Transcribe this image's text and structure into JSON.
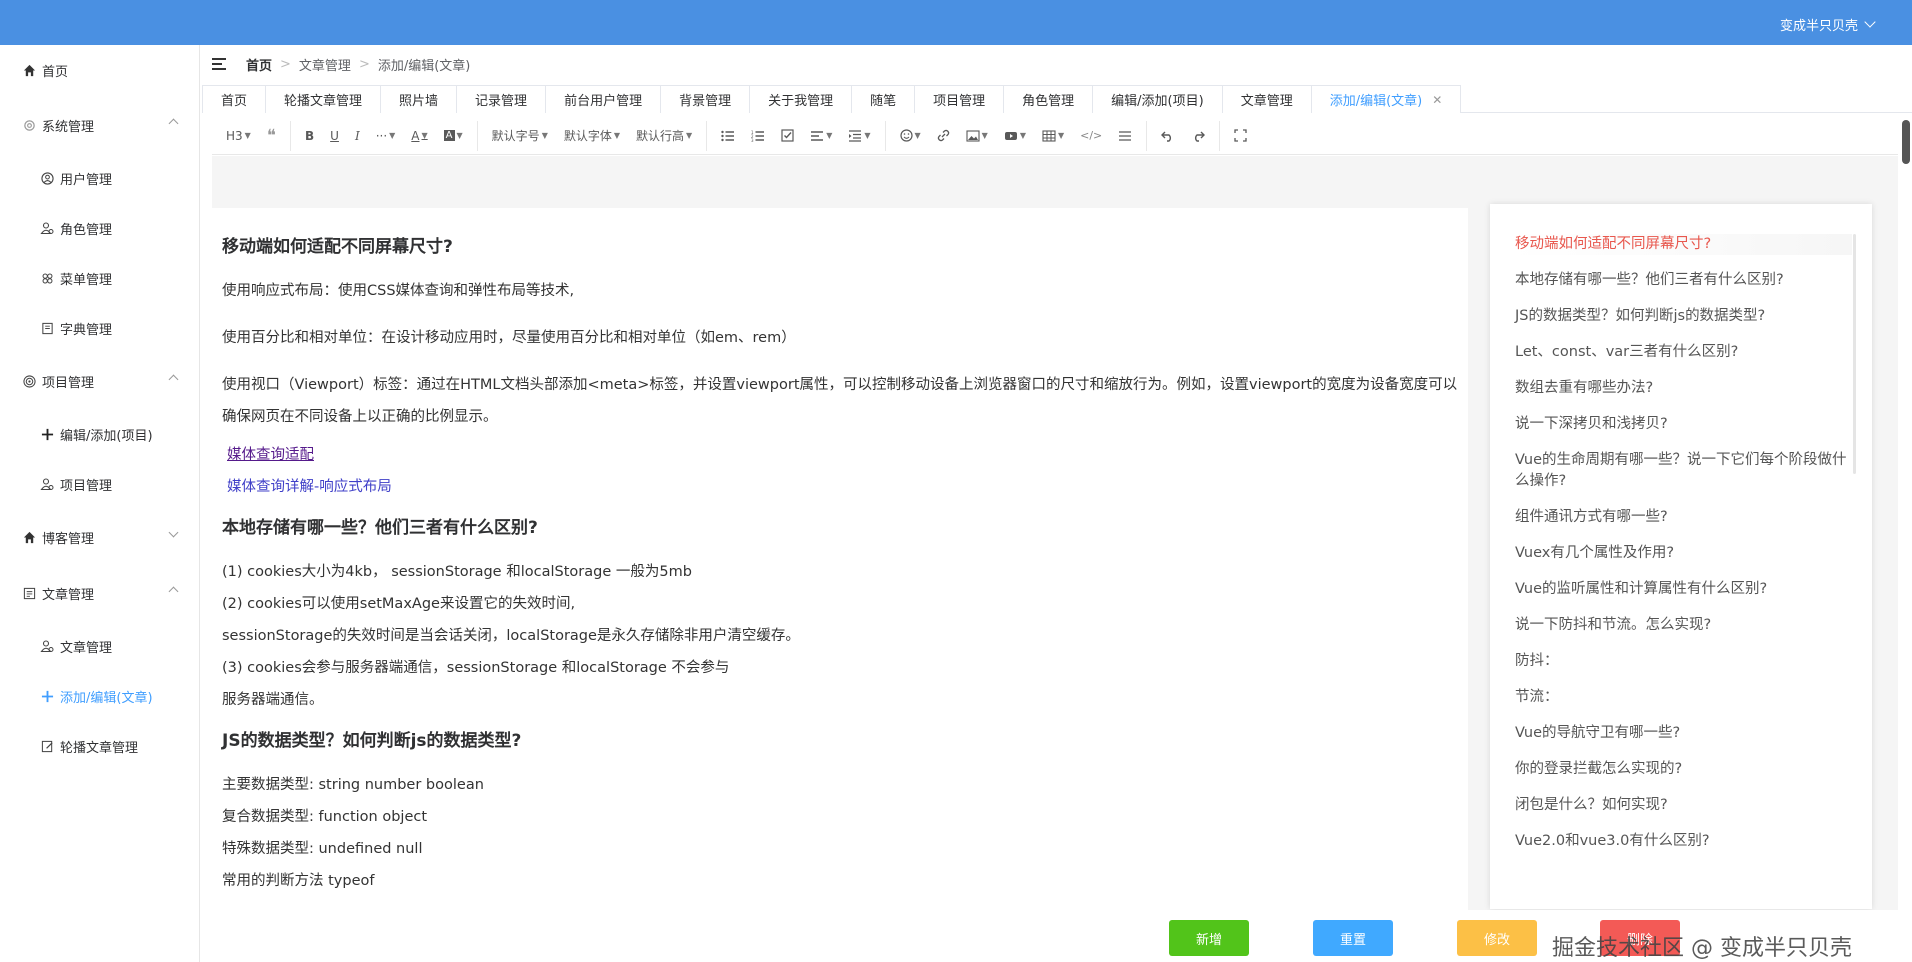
{
  "header": {
    "user_name": "变成半只贝壳"
  },
  "sidebar": {
    "items": [
      {
        "label": "首页",
        "icon": "home-icon"
      },
      {
        "label": "系统管理",
        "icon": "gear-icon"
      },
      {
        "label": "用户管理",
        "icon": "user-circle-icon"
      },
      {
        "label": "角色管理",
        "icon": "users-icon"
      },
      {
        "label": "菜单管理",
        "icon": "flower-icon"
      },
      {
        "label": "字典管理",
        "icon": "book-icon"
      },
      {
        "label": "项目管理",
        "icon": "target-icon"
      },
      {
        "label": "编辑/添加(项目)",
        "icon": "plus-icon"
      },
      {
        "label": "项目管理",
        "icon": "users-icon"
      },
      {
        "label": "博客管理",
        "icon": "home-icon"
      },
      {
        "label": "文章管理",
        "icon": "document-icon"
      },
      {
        "label": "文章管理",
        "icon": "users-icon"
      },
      {
        "label": "添加/编辑(文章)",
        "icon": "plus-icon"
      },
      {
        "label": "轮播文章管理",
        "icon": "edit-icon"
      }
    ]
  },
  "breadcrumb": [
    "首页",
    "文章管理",
    "添加/编辑(文章)"
  ],
  "tabs": [
    "首页",
    "轮播文章管理",
    "照片墙",
    "记录管理",
    "前台用户管理",
    "背景管理",
    "关于我管理",
    "随笔",
    "项目管理",
    "角色管理",
    "编辑/添加(项目)",
    "文章管理",
    "添加/编辑(文章)"
  ],
  "toolbar": {
    "heading": "H3",
    "font_size": "默认字号",
    "font_family": "默认字体",
    "line_height": "默认行高",
    "more": "···"
  },
  "document": {
    "h1": "移动端如何适配不同屏幕尺寸?",
    "p1": "使用响应式布局：使用CSS媒体查询和弹性布局等技术,",
    "p2": "使用百分比和相对单位：在设计移动应用时，尽量使用百分比和相对单位（如em、rem）",
    "p3": "使用视口（Viewport）标签：通过在HTML文档头部添加<meta>标签，并设置viewport属性，可以控制移动设备上浏览器窗口的尺寸和缩放行为。例如，设置viewport的宽度为设备宽度可以确保网页在不同设备上以正确的比例显示。",
    "link1": "媒体查询适配",
    "link2": "媒体查询详解-响应式布局",
    "h2": "本地存储有哪一些？他们三者有什么区别?",
    "p4": "(1) cookies大小为4kb， sessionStorage 和localStorage 一般为5mb",
    "p5": "(2) cookies可以使用setMaxAge来设置它的失效时间,",
    "p6": "sessionStorage的失效时间是当会话关闭，localStorage是永久存储除非用户清空缓存。",
    "p7": "(3) cookies会参与服务器端通信，sessionStorage 和localStorage 不会参与",
    "p8": "服务器端通信。",
    "h3": "JS的数据类型？如何判断js的数据类型?",
    "p9": "主要数据类型: string number boolean",
    "p10": "复合数据类型: function object",
    "p11": "特殊数据类型: undefined null",
    "p12": "常用的判断方法 typeof"
  },
  "toc": [
    "移动端如何适配不同屏幕尺寸?",
    "本地存储有哪一些？他们三者有什么区别?",
    "JS的数据类型？如何判断js的数据类型?",
    "Let、const、var三者有什么区别?",
    "数组去重有哪些办法?",
    "说一下深拷贝和浅拷贝?",
    "Vue的生命周期有哪一些？说一下它们每个阶段做什么操作?",
    "组件通讯方式有哪一些?",
    "Vuex有几个属性及作用?",
    "Vue的监听属性和计算属性有什么区别?",
    "说一下防抖和节流。怎么实现?",
    "防抖：",
    "节流：",
    "Vue的导航守卫有哪一些?",
    "你的登录拦截怎么实现的?",
    "闭包是什么？如何实现?",
    "Vue2.0和vue3.0有什么区别?"
  ],
  "actions": {
    "add": "新增",
    "reset": "重置",
    "edit": "修改",
    "delete": "删除"
  },
  "watermark": "掘金技术社区 @ 变成半只贝壳",
  "colors": {
    "header": "#4a90e2",
    "active": "#409eff",
    "add": "#52c41a",
    "reset": "#40a9ff",
    "edit": "#fcc046",
    "delete": "#f35a56",
    "toc_active": "#e8574d"
  }
}
